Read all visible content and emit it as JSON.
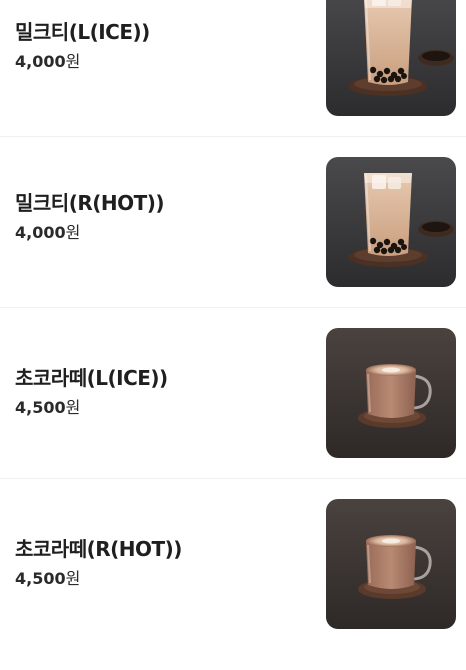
{
  "menu": {
    "items": [
      {
        "name": "밀크티(L(ICE))",
        "price": "4,000",
        "currency": "원",
        "image": "milk-tea-with-tapioca-pearls"
      },
      {
        "name": "밀크티(R(HOT))",
        "price": "4,000",
        "currency": "원",
        "image": "milk-tea-with-tapioca-pearls"
      },
      {
        "name": "초코라떼(L(ICE))",
        "price": "4,500",
        "currency": "원",
        "image": "chocolate-latte-glass-mug"
      },
      {
        "name": "초코라떼(R(HOT))",
        "price": "4,500",
        "currency": "원",
        "image": "chocolate-latte-glass-mug"
      }
    ]
  },
  "colors": {
    "divider": "#f0f0f0",
    "text": "#1f1f1f",
    "milk_tea_bg": "#3a3a3c",
    "latte_bg": "#3b3533",
    "saucer": "#5a3a2a"
  }
}
